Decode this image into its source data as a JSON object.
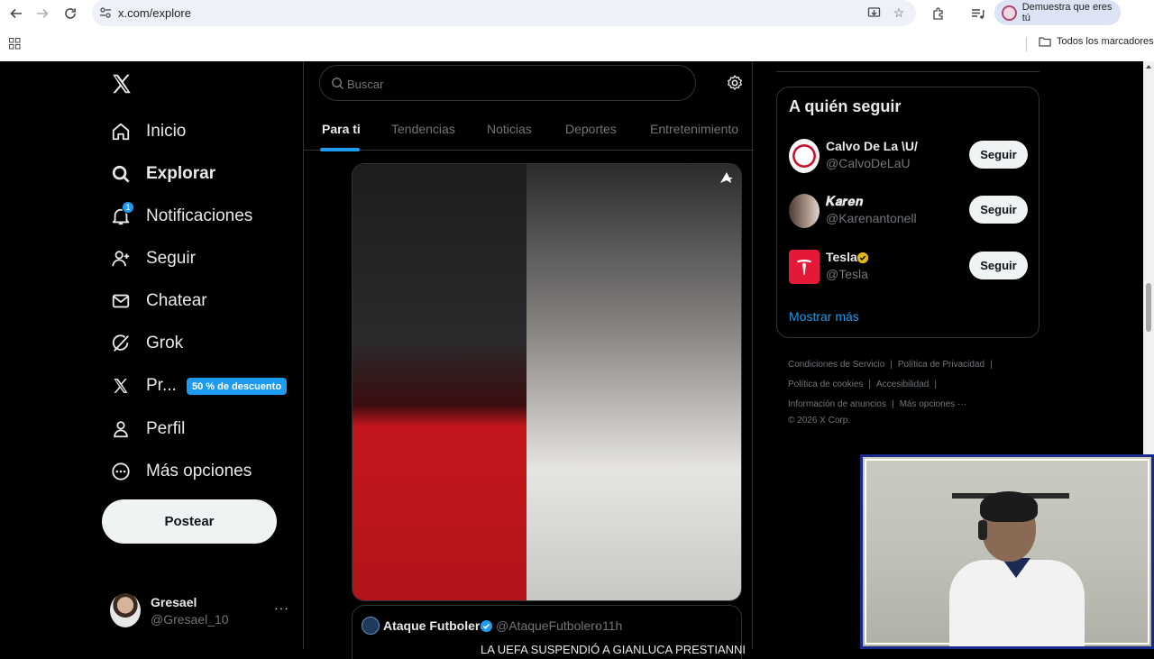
{
  "browser": {
    "url": "x.com/explore",
    "profile_chip": "Demuestra que eres tú",
    "bookmarks_folder": "Todos los marcadores"
  },
  "nav": {
    "items": [
      {
        "label": "Inicio",
        "icon": "home-icon"
      },
      {
        "label": "Explorar",
        "icon": "search-icon"
      },
      {
        "label": "Notificaciones",
        "icon": "bell-icon",
        "badge": "1"
      },
      {
        "label": "Seguir",
        "icon": "person-add-icon"
      },
      {
        "label": "Chatear",
        "icon": "envelope-icon"
      },
      {
        "label": "Grok",
        "icon": "grok-icon"
      },
      {
        "label": "Pr...",
        "icon": "x-premium-icon"
      },
      {
        "label": "Perfil",
        "icon": "person-icon"
      },
      {
        "label": "Más opciones",
        "icon": "more-circle-icon"
      }
    ],
    "promo_badge": "50 % de descuento",
    "post_button": "Postear",
    "account": {
      "name": "Gresael",
      "handle": "@Gresael_10",
      "more": "···"
    }
  },
  "main": {
    "search_placeholder": "Buscar",
    "tabs": [
      {
        "label": "Para ti",
        "active": true
      },
      {
        "label": "Tendencias",
        "active": false
      },
      {
        "label": "Noticias",
        "active": false
      },
      {
        "label": "Deportes",
        "active": false
      },
      {
        "label": "Entretenimiento",
        "active": false
      }
    ],
    "post": {
      "author": "Ataque Futbolero",
      "handle": "@AtaqueFutbolero",
      "dot": "·",
      "time": "11h",
      "text": "LA UEFA SUSPENDIÓ A GIANLUCA PRESTIANNI"
    }
  },
  "sidebar": {
    "who_to_follow_title": "A quién seguir",
    "suggestions": [
      {
        "name": "Calvo De La \\U/",
        "handle": "@CalvoDeLaU",
        "button": "Seguir"
      },
      {
        "name": "𝑲𝒂𝒓𝒆𝒏",
        "handle": "@Karenantonell",
        "button": "Seguir"
      },
      {
        "name": "Tesla",
        "handle": "@Tesla",
        "button": "Seguir",
        "verified": "gold"
      }
    ],
    "show_more": "Mostrar más",
    "footer": {
      "terms": "Condiciones de Servicio",
      "privacy": "Política de Privacidad",
      "cookies": "Política de cookies",
      "accessibility": "Accesibilidad",
      "ads_info": "Información de anuncios",
      "more": "Más opciones ···",
      "copyright": "© 2026 X Corp."
    }
  },
  "colors": {
    "accent": "#1d9bf0",
    "background": "#000000",
    "text_primary": "#e7e9ea",
    "text_secondary": "#71767b",
    "border": "#2f3336"
  }
}
